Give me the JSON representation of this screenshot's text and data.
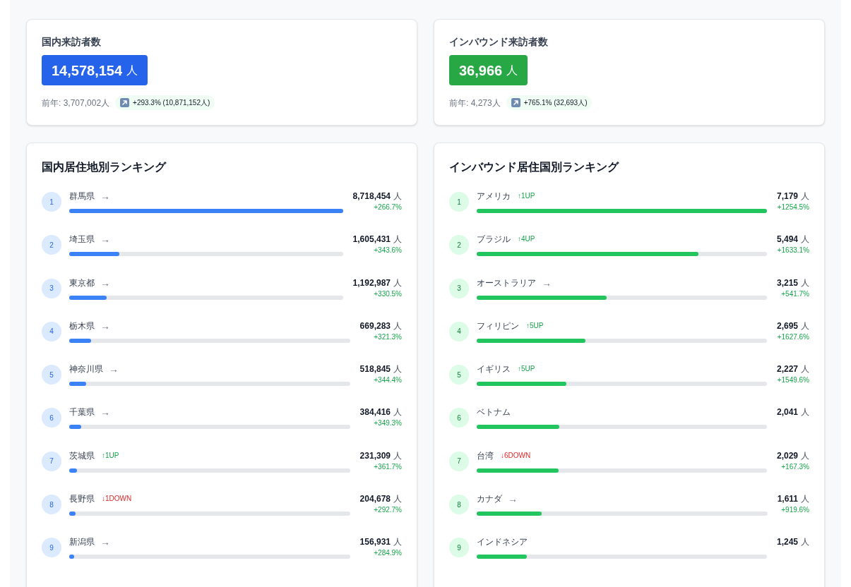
{
  "summary_cards": [
    {
      "kind": "domestic",
      "title": "国内来訪者数",
      "value": "14,578,154",
      "unit": "人",
      "previous": "前年: 3,707,002人",
      "change": "+293.3% (10,871,152人)"
    },
    {
      "kind": "inbound",
      "title": "インバウンド来訪者数",
      "value": "36,966",
      "unit": "人",
      "previous": "前年: 4,273人",
      "change": "+765.1% (32,693人)"
    }
  ],
  "rankings": [
    {
      "kind": "domestic",
      "title": "国内居住地別ランキング",
      "rows": [
        {
          "rank": "1",
          "name": "群馬県",
          "change": {
            "kind": "same",
            "text": "→"
          },
          "count": "8,718,454",
          "unit": "人",
          "growth": "+266.7%",
          "level": 1
        },
        {
          "rank": "2",
          "name": "埼玉県",
          "change": {
            "kind": "same",
            "text": "→"
          },
          "count": "1,605,431",
          "unit": "人",
          "growth": "+343.6%",
          "level": 0.184
        },
        {
          "rank": "3",
          "name": "東京都",
          "change": {
            "kind": "same",
            "text": "→"
          },
          "count": "1,192,987",
          "unit": "人",
          "growth": "+330.5%",
          "level": 0.137
        },
        {
          "rank": "4",
          "name": "栃木県",
          "change": {
            "kind": "same",
            "text": "→"
          },
          "count": "669,283",
          "unit": "人",
          "growth": "+321.3%",
          "level": 0.077
        },
        {
          "rank": "5",
          "name": "神奈川県",
          "change": {
            "kind": "same",
            "text": "→"
          },
          "count": "518,845",
          "unit": "人",
          "growth": "+344.4%",
          "level": 0.06
        },
        {
          "rank": "6",
          "name": "千葉県",
          "change": {
            "kind": "same",
            "text": "→"
          },
          "count": "384,416",
          "unit": "人",
          "growth": "+349.3%",
          "level": 0.044
        },
        {
          "rank": "7",
          "name": "茨城県",
          "change": {
            "kind": "up",
            "text": "↑1UP"
          },
          "count": "231,309",
          "unit": "人",
          "growth": "+361.7%",
          "level": 0.027
        },
        {
          "rank": "8",
          "name": "長野県",
          "change": {
            "kind": "down",
            "text": "↓1DOWN"
          },
          "count": "204,678",
          "unit": "人",
          "growth": "+292.7%",
          "level": 0.023
        },
        {
          "rank": "9",
          "name": "新潟県",
          "change": {
            "kind": "same",
            "text": "→"
          },
          "count": "156,931",
          "unit": "人",
          "growth": "+284.9%",
          "level": 0.018
        }
      ]
    },
    {
      "kind": "inbound",
      "title": "インバウンド居住国別ランキング",
      "rows": [
        {
          "rank": "1",
          "name": "アメリカ",
          "change": {
            "kind": "up",
            "text": "↑1UP"
          },
          "count": "7,179",
          "unit": "人",
          "growth": "+1254.5%",
          "level": 1
        },
        {
          "rank": "2",
          "name": "ブラジル",
          "change": {
            "kind": "up",
            "text": "↑4UP"
          },
          "count": "5,494",
          "unit": "人",
          "growth": "+1633.1%",
          "level": 0.765
        },
        {
          "rank": "3",
          "name": "オーストラリア",
          "change": {
            "kind": "same",
            "text": "→"
          },
          "count": "3,215",
          "unit": "人",
          "growth": "+541.7%",
          "level": 0.448
        },
        {
          "rank": "4",
          "name": "フィリピン",
          "change": {
            "kind": "up",
            "text": "↑5UP"
          },
          "count": "2,695",
          "unit": "人",
          "growth": "+1627.6%",
          "level": 0.375
        },
        {
          "rank": "5",
          "name": "イギリス",
          "change": {
            "kind": "up",
            "text": "↑5UP"
          },
          "count": "2,227",
          "unit": "人",
          "growth": "+1549.6%",
          "level": 0.31
        },
        {
          "rank": "6",
          "name": "ベトナム",
          "count": "2,041",
          "unit": "人",
          "level": 0.284
        },
        {
          "rank": "7",
          "name": "台湾",
          "change": {
            "kind": "down",
            "text": "↓6DOWN"
          },
          "count": "2,029",
          "unit": "人",
          "growth": "+167.3%",
          "level": 0.283
        },
        {
          "rank": "8",
          "name": "カナダ",
          "change": {
            "kind": "same",
            "text": "→"
          },
          "count": "1,611",
          "unit": "人",
          "growth": "+919.6%",
          "level": 0.224
        },
        {
          "rank": "9",
          "name": "インドネシア",
          "count": "1,245",
          "unit": "人",
          "level": 0.173
        }
      ]
    }
  ]
}
